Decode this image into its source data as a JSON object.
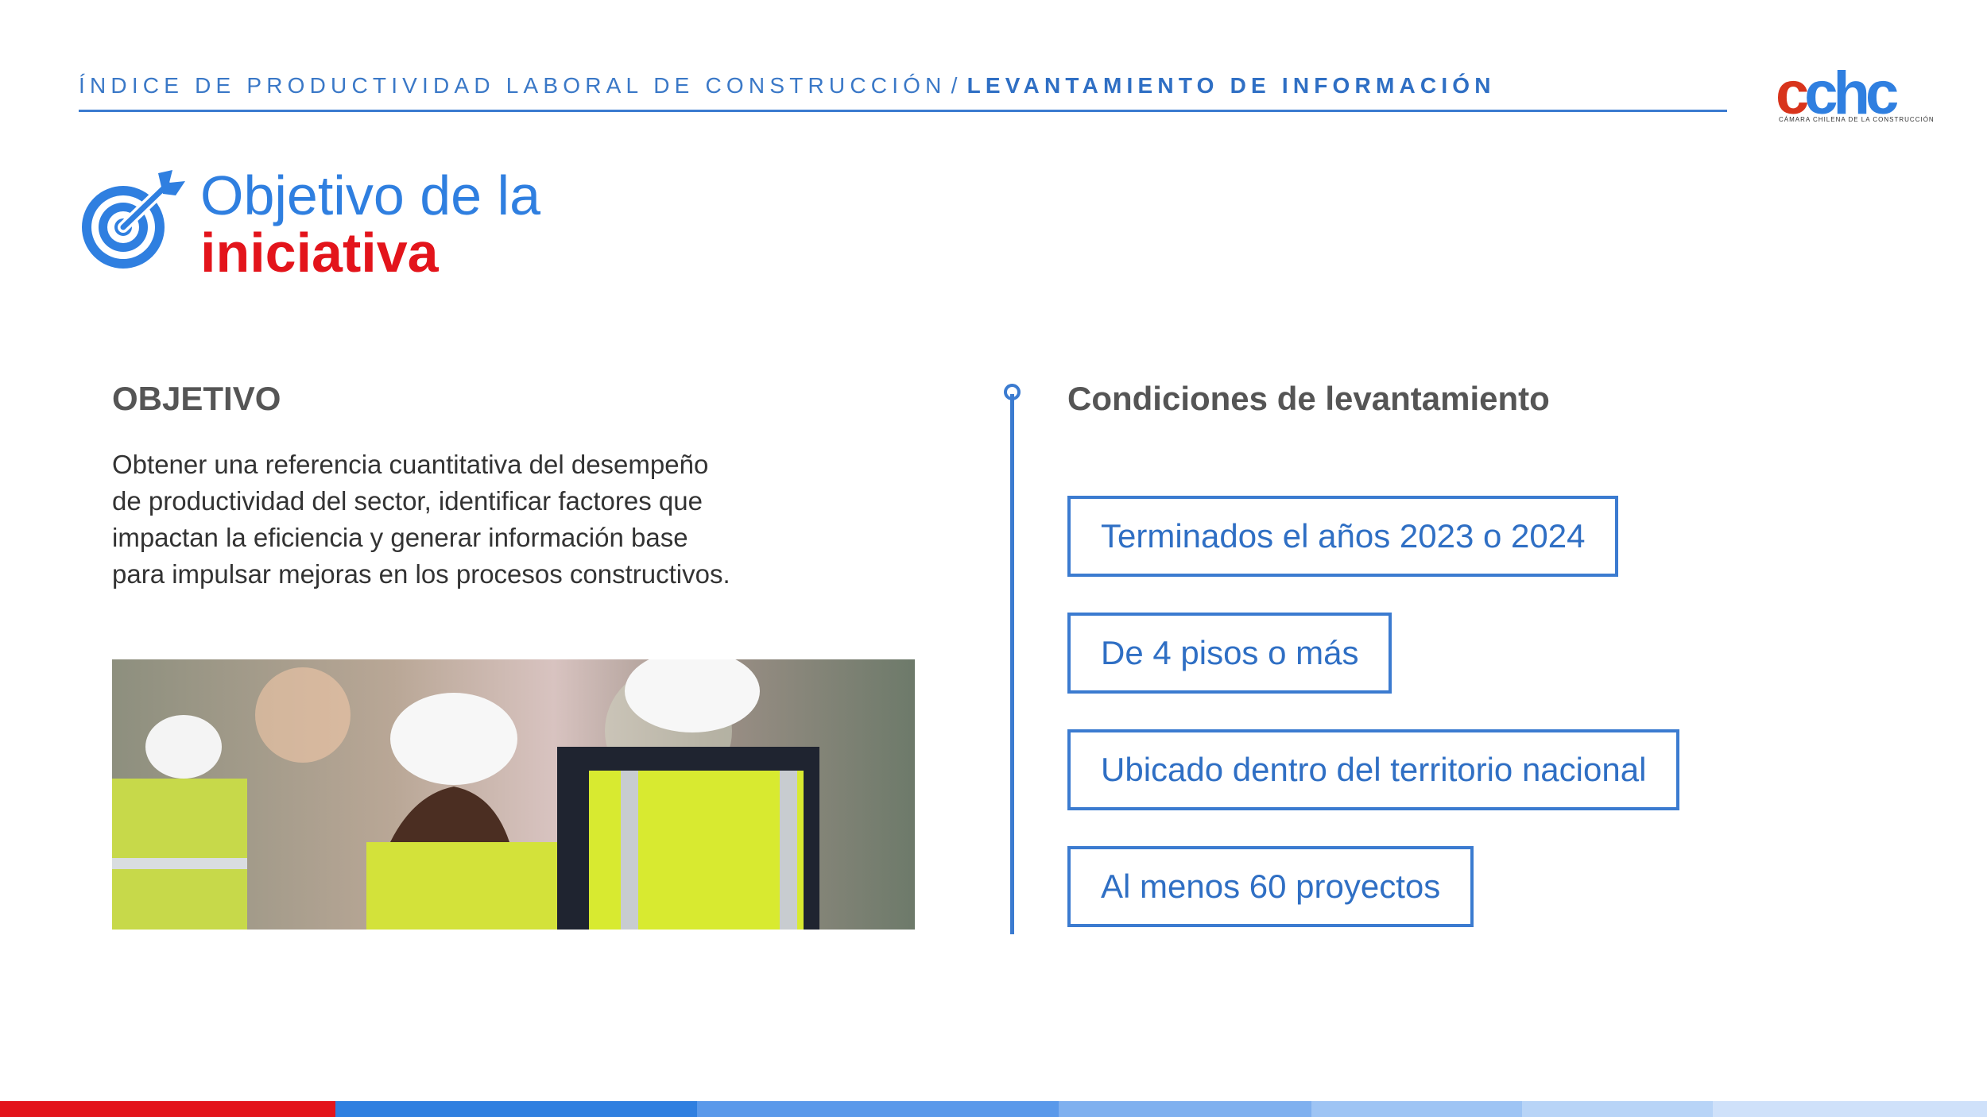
{
  "header": {
    "breadcrumb_main": "ÍNDICE DE PRODUCTIVIDAD LABORAL DE CONSTRUCCIÓN",
    "separator": "/",
    "breadcrumb_section": "LEVANTAMIENTO DE INFORMACIÓN"
  },
  "logo": {
    "brand_red": "c",
    "brand_blue": "chc",
    "tagline": "CÁMARA CHILENA DE LA CONSTRUCCIÓN",
    "icon": "cchc-logo"
  },
  "title": {
    "line1": "Objetivo de la",
    "line2": "iniciativa",
    "icon": "target-icon"
  },
  "objective": {
    "heading": "OBJETIVO",
    "text": "Obtener una referencia cuantitativa del desempeño de productividad del sector, identificar factores que impactan la eficiencia y generar información base para impulsar mejoras en los procesos constructivos."
  },
  "conditions": {
    "heading": "Condiciones de levantamiento",
    "items": [
      "Terminados el años 2023 o 2024",
      "De 4 pisos o más",
      "Ubicado dentro del territorio nacional",
      "Al menos 60 proyectos"
    ]
  },
  "colors": {
    "primary_blue": "#2f7fe0",
    "accent_red": "#e3141b",
    "text_gray": "#555555",
    "bar_segments": [
      "#e3141b",
      "#2f7fe0",
      "#5a99ea",
      "#7fb0ef",
      "#9ec4f4",
      "#b8d4f7",
      "#cfe1fa"
    ]
  }
}
